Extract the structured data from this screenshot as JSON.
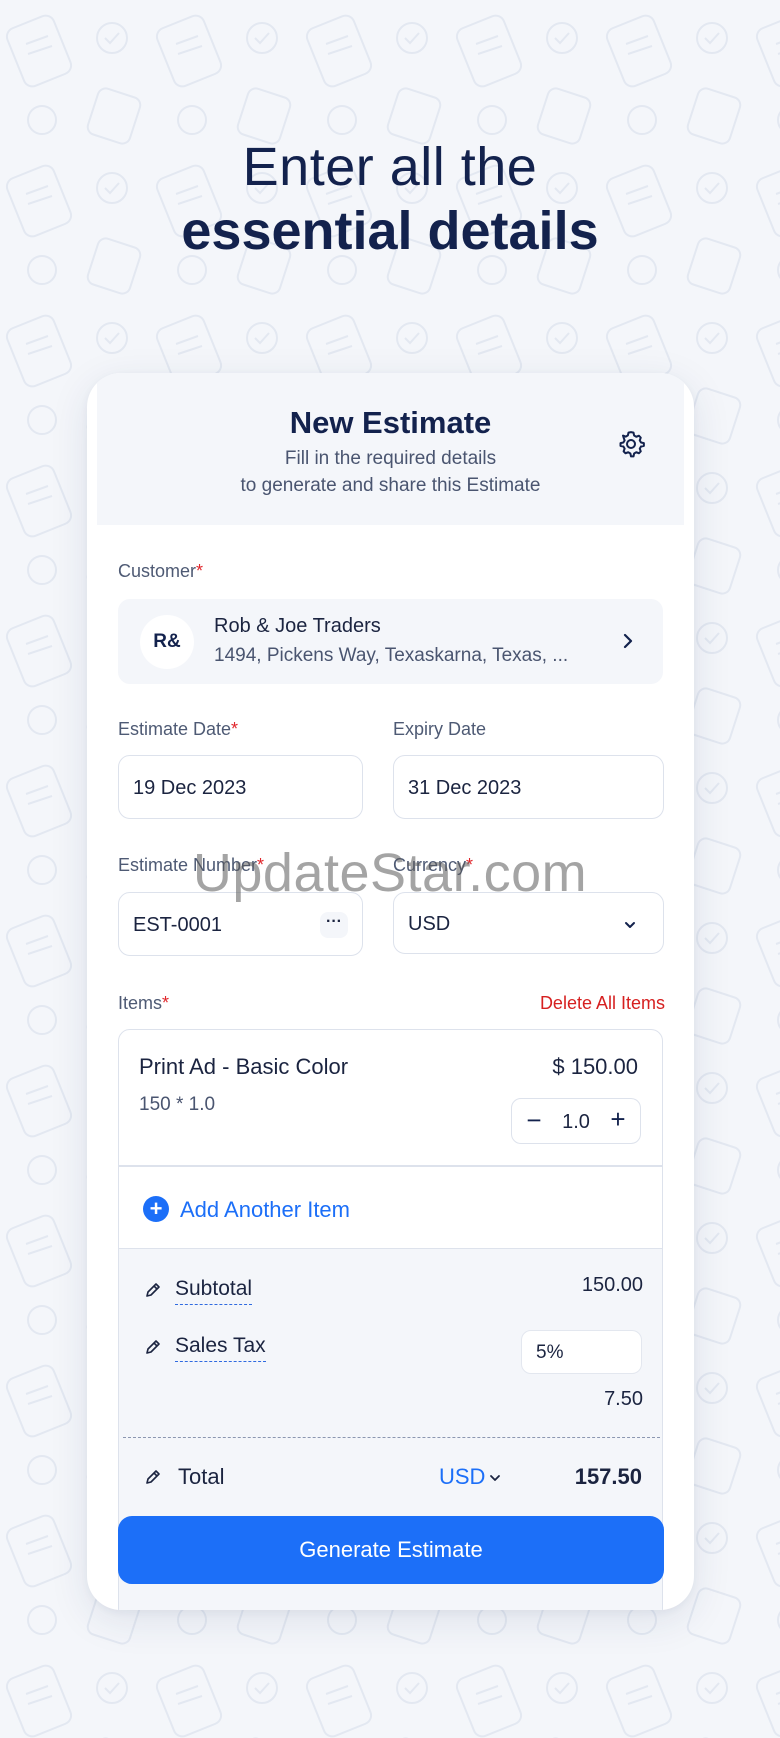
{
  "headline": {
    "line1": "Enter all the",
    "line2": "essential details"
  },
  "card": {
    "title": "New Estimate",
    "subtitle_line1": "Fill in the required details",
    "subtitle_line2": "to generate and share this Estimate",
    "settings_icon": "gear-icon"
  },
  "customer": {
    "label": "Customer",
    "required_mark": "*",
    "initials": "R&",
    "name": "Rob & Joe Traders",
    "address": "1494, Pickens Way, Texaskarna, Texas, ..."
  },
  "dates": {
    "estimate_label": "Estimate Date",
    "estimate_required": "*",
    "estimate_value": "19 Dec 2023",
    "expiry_label": "Expiry Date",
    "expiry_value": "31 Dec 2023"
  },
  "numbering": {
    "number_label": "Estimate Number",
    "number_required": "*",
    "number_value": "EST-0001",
    "more_glyph": "···",
    "currency_label": "Currency",
    "currency_required": "*",
    "currency_value": "USD"
  },
  "items": {
    "label": "Items",
    "required_mark": "*",
    "delete_all": "Delete All Items",
    "list": [
      {
        "name": "Print Ad - Basic Color",
        "price": "$ 150.00",
        "calc": "150 * 1.0",
        "quantity": "1.0"
      }
    ],
    "add_another": "Add Another Item"
  },
  "totals": {
    "subtotal_label": "Subtotal",
    "subtotal_value": "150.00",
    "tax_label": "Sales Tax",
    "tax_rate": "5%",
    "tax_amount": "7.50",
    "total_label": "Total",
    "total_currency": "USD",
    "total_value": "157.50"
  },
  "generate_button": "Generate Estimate",
  "watermark": "UpdateStar.com",
  "colors": {
    "primary": "#1c6ff8",
    "heading": "#13224d",
    "required": "#e0262b",
    "delete": "#d62020"
  }
}
